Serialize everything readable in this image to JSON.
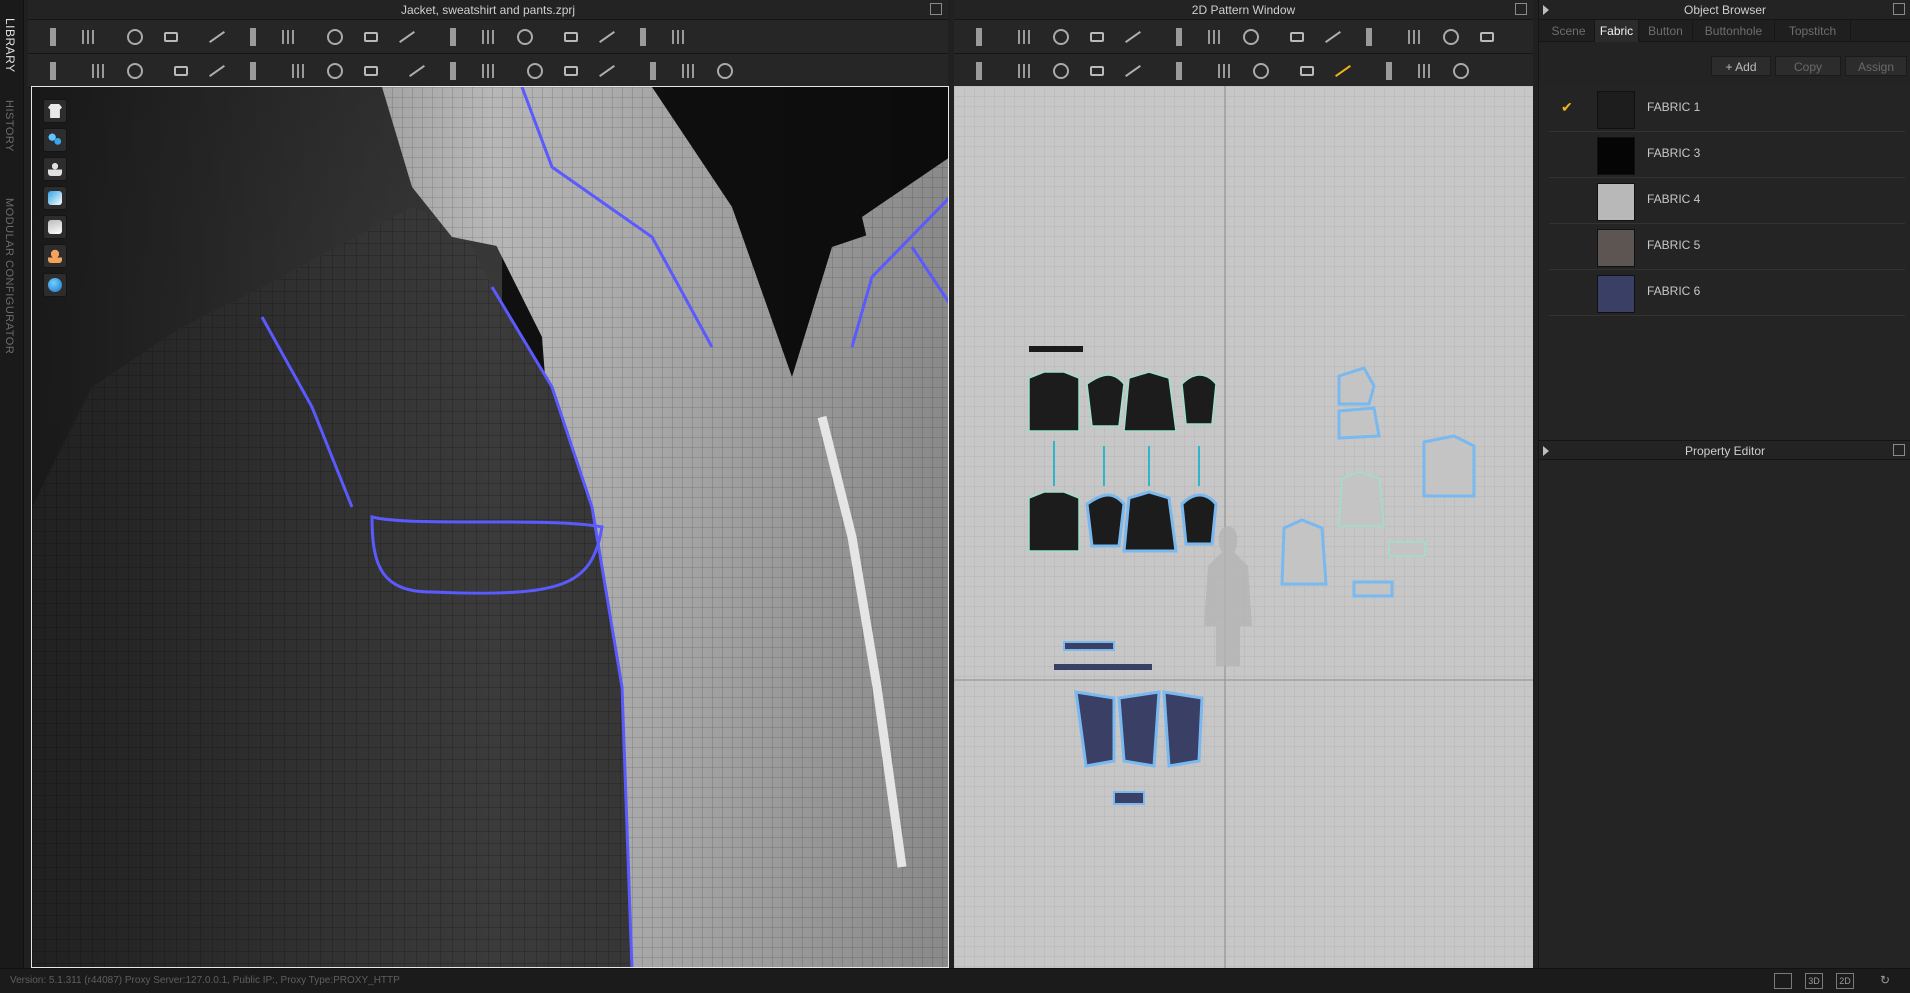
{
  "left_strip": {
    "tabs": [
      "LIBRARY",
      "HISTORY",
      "MODULAR CONFIGURATOR"
    ]
  },
  "window3d": {
    "title": "Jacket, sweatshirt and pants.zprj"
  },
  "window2d": {
    "title": "2D Pattern Window"
  },
  "object_browser": {
    "title": "Object Browser",
    "tabs": [
      "Scene",
      "Fabric",
      "Button",
      "Buttonhole",
      "Topstitch"
    ],
    "active_tab": "Fabric",
    "actions": {
      "add": "+ Add",
      "copy": "Copy",
      "assign": "Assign"
    },
    "fabrics": [
      {
        "name": "FABRIC 1",
        "color": "#1d1d1d",
        "checked": true
      },
      {
        "name": "FABRIC 3",
        "color": "#050505",
        "checked": false
      },
      {
        "name": "FABRIC 4",
        "color": "#b8b8b8",
        "checked": false
      },
      {
        "name": "FABRIC 5",
        "color": "#5d5552",
        "checked": false
      },
      {
        "name": "FABRIC 6",
        "color": "#3a3f66",
        "checked": false
      }
    ]
  },
  "property_editor": {
    "title": "Property Editor"
  },
  "status": {
    "text": "Version: 5.1.311 (r44087)    Proxy Server:127.0.0.1, Public IP:, Proxy Type:PROXY_HTTP",
    "view_buttons": [
      "",
      "3D",
      "2D",
      "↻"
    ]
  },
  "colors": {
    "accent": "#f2b31b",
    "seam_blue": "#5a5aff",
    "pattern_bg": "#c7c7c7"
  }
}
